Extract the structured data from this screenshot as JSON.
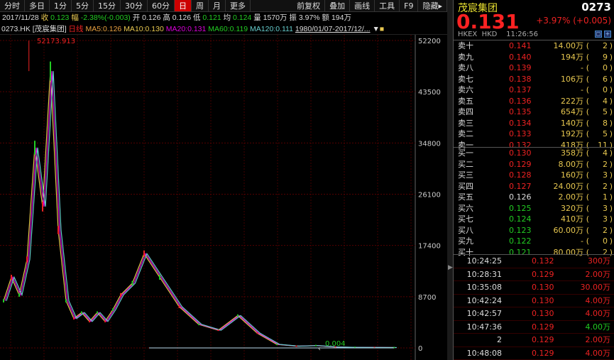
{
  "toolbar": {
    "items": [
      "分时",
      "多日",
      "1分",
      "5分",
      "15分",
      "30分",
      "60分",
      "日",
      "周",
      "月",
      "更多"
    ],
    "active": "日",
    "right": [
      "前复权",
      "叠加",
      "画线",
      "工具",
      "F9",
      "隐藏▸"
    ]
  },
  "quote": {
    "date": "2017/11/28",
    "close_label": "收",
    "close": "0.123",
    "amp_label": "幅",
    "amp": "-2.38%(-0.003)",
    "open_label": "开",
    "open": "0.126",
    "high_label": "高",
    "high": "0.126",
    "low_label": "低",
    "low": "0.121",
    "avg_label": "均",
    "avg": "0.124",
    "vol_label": "量",
    "vol": "1570万",
    "swing_label": "振",
    "swing": "3.97%",
    "amt_label": "额",
    "amt": "194万"
  },
  "ma": {
    "code": "0273.HK [茂宸集团]",
    "type": "日线",
    "ma5": "MA5:0.126",
    "ma10": "MA10:0.130",
    "ma20": "MA20:0.131",
    "ma60": "MA60:0.119",
    "ma120": "MA120:0.111",
    "range": "1980/01/07-2017/12/..."
  },
  "colors": {
    "ma5": "#e8c850",
    "ma10": "#e8e030",
    "ma20": "#d0d",
    "ma60": "#2c2",
    "ma120": "#6cc",
    "up": "#e22",
    "down": "#2c2"
  },
  "chart_data": {
    "type": "line",
    "ylim": [
      0,
      52200
    ],
    "y_ticks": [
      "52200",
      "43500",
      "34800",
      "26100",
      "17400",
      "8700",
      "0"
    ],
    "max_label": "52173.913",
    "min_label": "0.004",
    "x": [
      0,
      2,
      4,
      6,
      8,
      10,
      12,
      14,
      16,
      18,
      20,
      22,
      24,
      26,
      28,
      30,
      33,
      36,
      40,
      45,
      50,
      55,
      60,
      65,
      70,
      75,
      80,
      85,
      90,
      95,
      100
    ],
    "values": [
      8000,
      12000,
      9000,
      15000,
      34000,
      24000,
      47000,
      20000,
      8000,
      5000,
      6000,
      4500,
      6000,
      4500,
      6500,
      9000,
      11000,
      16000,
      12000,
      7000,
      4000,
      3000,
      5500,
      2500,
      600,
      300,
      400,
      150,
      100,
      80,
      60
    ]
  },
  "right": {
    "name": "茂宸集团",
    "code": "0273",
    "price": "0.131",
    "change": "+3.97% (+0.005)",
    "meta": "HKEX  HKD    11:26:56"
  },
  "asks": [
    {
      "label": "卖十",
      "price": "0.141",
      "vol": "14.00万",
      "count": "2"
    },
    {
      "label": "卖九",
      "price": "0.140",
      "vol": "194万",
      "count": "9"
    },
    {
      "label": "卖八",
      "price": "0.139",
      "vol": "-",
      "count": "0"
    },
    {
      "label": "卖七",
      "price": "0.138",
      "vol": "106万",
      "count": "6"
    },
    {
      "label": "卖六",
      "price": "0.137",
      "vol": "-",
      "count": "0"
    },
    {
      "label": "卖五",
      "price": "0.136",
      "vol": "222万",
      "count": "4"
    },
    {
      "label": "卖四",
      "price": "0.135",
      "vol": "654万",
      "count": "5"
    },
    {
      "label": "卖三",
      "price": "0.134",
      "vol": "140万",
      "count": "8"
    },
    {
      "label": "卖二",
      "price": "0.133",
      "vol": "192万",
      "count": "5"
    },
    {
      "label": "卖一",
      "price": "0.132",
      "vol": "418万",
      "count": "11"
    }
  ],
  "bids": [
    {
      "label": "买一",
      "price": "0.130",
      "vol": "358万",
      "count": "4",
      "color": "#e22"
    },
    {
      "label": "买二",
      "price": "0.129",
      "vol": "8.00万",
      "count": "2",
      "color": "#e22"
    },
    {
      "label": "买三",
      "price": "0.128",
      "vol": "160万",
      "count": "3",
      "color": "#e22"
    },
    {
      "label": "买四",
      "price": "0.127",
      "vol": "24.00万",
      "count": "2",
      "color": "#e22"
    },
    {
      "label": "买五",
      "price": "0.126",
      "vol": "2.00万",
      "count": "1",
      "color": "#ddd"
    },
    {
      "label": "买六",
      "price": "0.125",
      "vol": "320万",
      "count": "3",
      "color": "#2c2"
    },
    {
      "label": "买七",
      "price": "0.124",
      "vol": "410万",
      "count": "3",
      "color": "#2c2"
    },
    {
      "label": "买八",
      "price": "0.123",
      "vol": "60.00万",
      "count": "2",
      "color": "#2c2"
    },
    {
      "label": "买九",
      "price": "0.122",
      "vol": "-",
      "count": "0",
      "color": "#2c2"
    },
    {
      "label": "买十",
      "price": "0.121",
      "vol": "80.00万",
      "count": "2",
      "color": "#2c2"
    }
  ],
  "ticks": [
    {
      "time": "10:24:25",
      "price": "0.132",
      "vol": "300万",
      "vc": "#e22"
    },
    {
      "time": "10:28:31",
      "price": "0.129",
      "vol": "2.00万",
      "vc": "#e22"
    },
    {
      "time": "10:35:08",
      "price": "0.130",
      "vol": "30.00万",
      "vc": "#e22"
    },
    {
      "time": "10:42:24",
      "price": "0.130",
      "vol": "4.00万",
      "vc": "#e22"
    },
    {
      "time": "10:42:57",
      "price": "0.130",
      "vol": "4.00万",
      "vc": "#e22"
    },
    {
      "time": "10:47:36",
      "price": "0.129",
      "vol": "4.00万",
      "vc": "#2c2"
    },
    {
      "time": "2",
      "price": "0.129",
      "vol": "2.00万",
      "vc": "#e22"
    },
    {
      "time": "10:48:08",
      "price": "0.129",
      "vol": "4.00万",
      "vc": "#e22"
    }
  ]
}
